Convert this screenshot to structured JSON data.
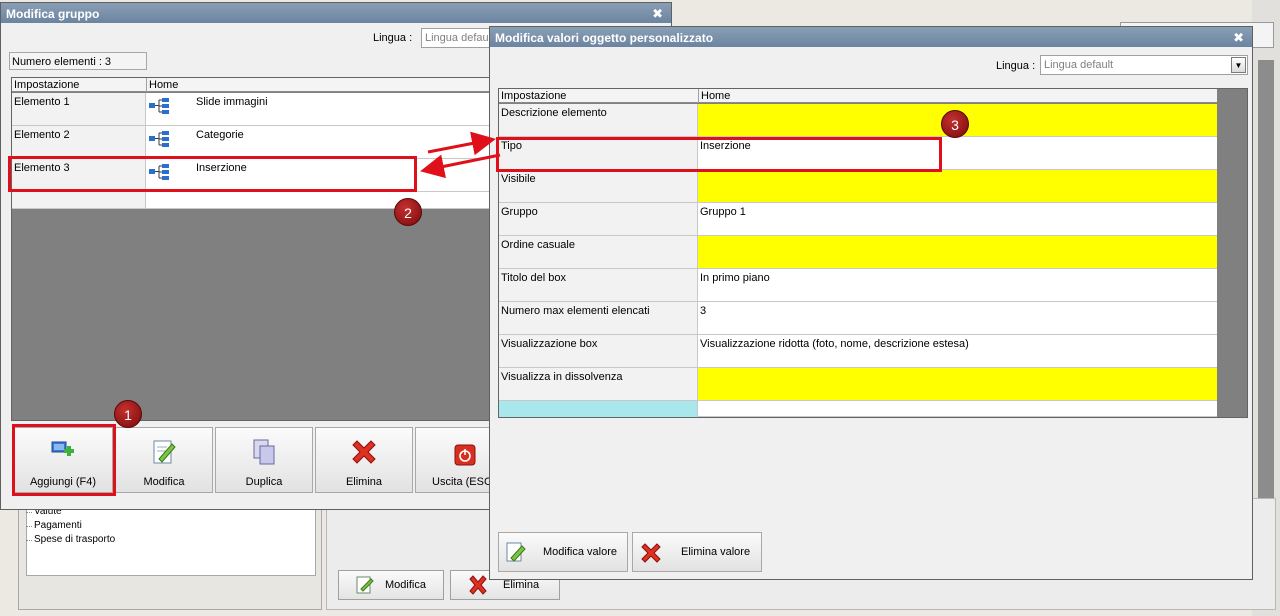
{
  "background": {
    "tree_items": [
      "Valute",
      "Pagamenti",
      "Spese di trasporto"
    ],
    "buttons": {
      "modifica": "Modifica",
      "elimina": "Elimina"
    }
  },
  "group_window": {
    "title": "Modifica gruppo",
    "lingua_label": "Lingua :",
    "lingua_value": "Lingua default",
    "count_label": "Numero elementi : 3",
    "columns": [
      "Impostazione",
      "Home"
    ],
    "rows": [
      {
        "setting": "Elemento 1",
        "value": "Slide immagini"
      },
      {
        "setting": "Elemento 2",
        "value": "Categorie"
      },
      {
        "setting": "Elemento 3",
        "value": "Inserzione"
      }
    ],
    "buttons": {
      "add": "Aggiungi (F4)",
      "modify": "Modifica",
      "duplicate": "Duplica",
      "delete": "Elimina",
      "exit": "Uscita (ESC)"
    }
  },
  "object_window": {
    "title": "Modifica valori oggetto personalizzato",
    "lingua_label": "Lingua :",
    "lingua_value": "Lingua default",
    "columns": [
      "Impostazione",
      "Home"
    ],
    "rows": [
      {
        "setting": "Descrizione elemento",
        "value": "",
        "highlight": true
      },
      {
        "setting": "Tipo",
        "value": "Inserzione",
        "highlight": false
      },
      {
        "setting": "Visibile",
        "value": "",
        "highlight": true
      },
      {
        "setting": "Gruppo",
        "value": "Gruppo 1",
        "highlight": false
      },
      {
        "setting": "Ordine casuale",
        "value": "",
        "highlight": true
      },
      {
        "setting": "Titolo del box",
        "value": "In primo piano",
        "highlight": false
      },
      {
        "setting": "Numero max elementi elencati",
        "value": "3",
        "highlight": false
      },
      {
        "setting": "Visualizzazione box",
        "value": "Visualizzazione ridotta (foto, nome, descrizione estesa)",
        "highlight": false
      },
      {
        "setting": "Visualizza in dissolvenza",
        "value": "",
        "highlight": true
      }
    ],
    "buttons": {
      "modify_value": "Modifica valore",
      "delete_value": "Elimina valore"
    }
  },
  "annotations": {
    "badge1": "1",
    "badge2": "2",
    "badge3": "3"
  },
  "colors": {
    "highlight_yellow": "#ffff00",
    "annotation_red": "#e0101a",
    "titlebar": "#7088a4"
  }
}
